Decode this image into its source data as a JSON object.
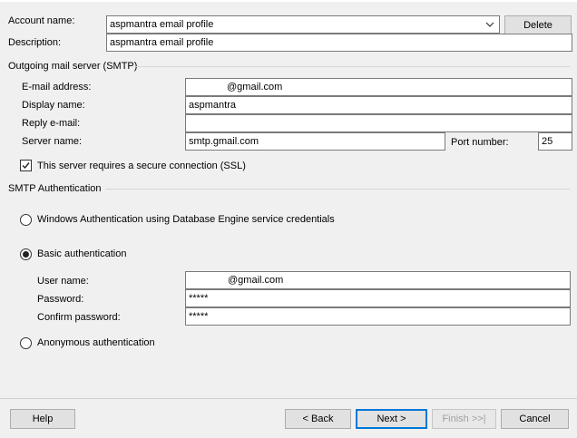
{
  "account": {
    "name_label": "Account name:",
    "name_value": "aspmantra email profile",
    "delete_label": "Delete",
    "description_label": "Description:",
    "description_value": "aspmantra email profile"
  },
  "smtp": {
    "section_title": "Outgoing mail server (SMTP)",
    "email_label": "E-mail address:",
    "email_value": "@gmail.com",
    "display_name_label": "Display name:",
    "display_name_value": "aspmantra",
    "reply_label": "Reply e-mail:",
    "reply_value": "",
    "server_label": "Server name:",
    "server_value": "smtp.gmail.com",
    "port_label": "Port number:",
    "port_value": "25",
    "ssl_label": "This server requires a secure connection (SSL)",
    "ssl_checked": true
  },
  "auth": {
    "section_title": "SMTP Authentication",
    "windows_label": "Windows Authentication using Database Engine service credentials",
    "basic_label": "Basic authentication",
    "selected": "basic",
    "user_label": "User name:",
    "user_value": "@gmail.com",
    "password_label": "Password:",
    "password_value": "*****",
    "confirm_label": "Confirm password:",
    "confirm_value": "*****",
    "anonymous_label": "Anonymous authentication"
  },
  "footer": {
    "help": "Help",
    "back": "< Back",
    "next": "Next >",
    "finish": "Finish >>|",
    "cancel": "Cancel"
  }
}
